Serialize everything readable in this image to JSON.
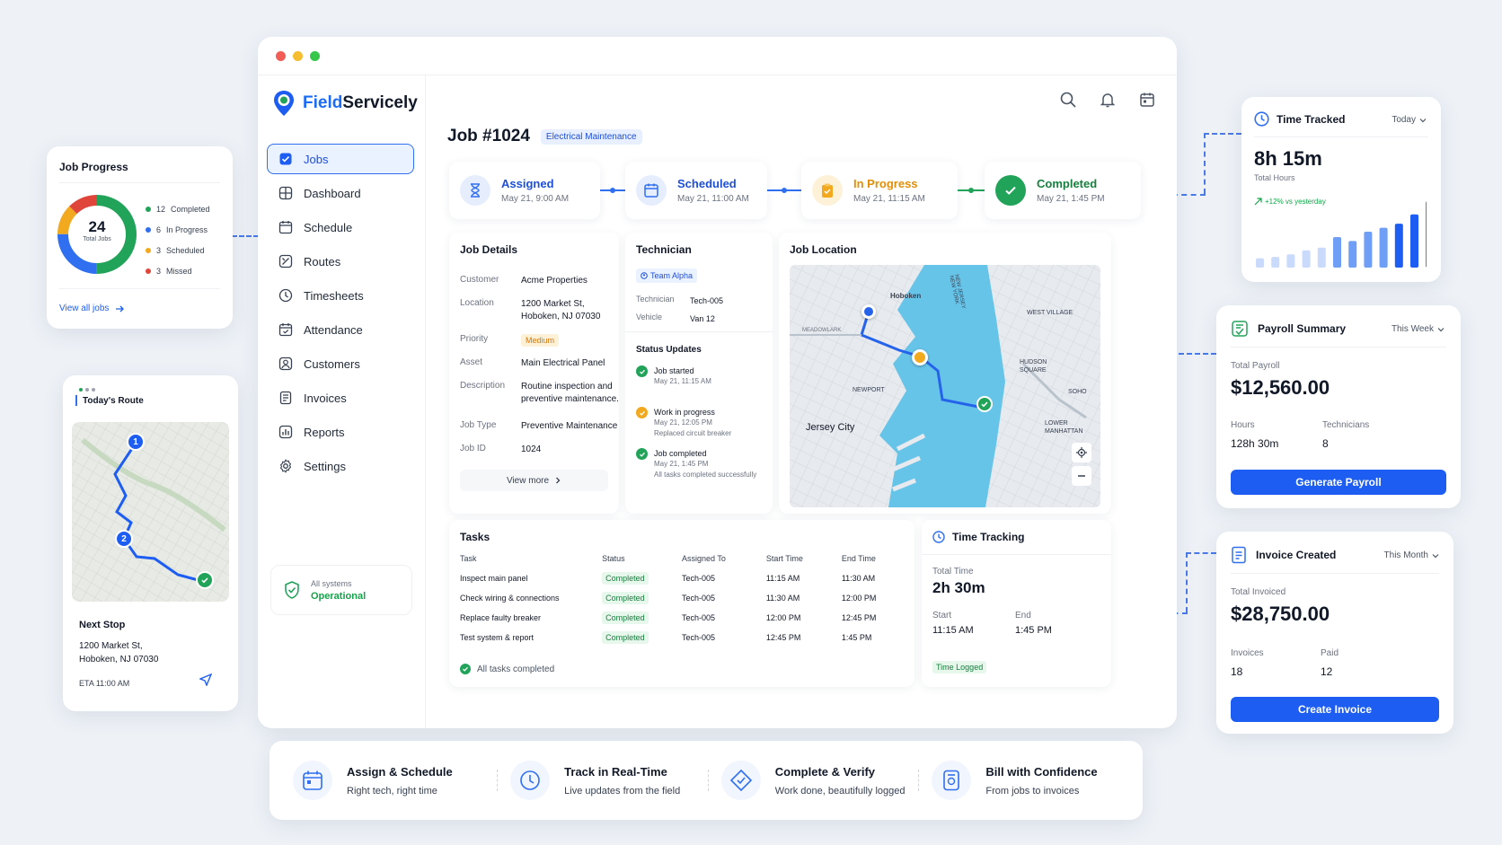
{
  "app": {
    "name_prefix": "Field",
    "name_suffix": "Servicely"
  },
  "colors": {
    "accent": "#1d5df2",
    "success": "#22a35a",
    "warning": "#f2a91d",
    "danger": "#e0453a",
    "map_water": "#67c4e9"
  },
  "window_controls": [
    "close",
    "minimize",
    "maximize"
  ],
  "sidebar": {
    "items": [
      {
        "label": "Jobs",
        "icon": "check-square-icon",
        "active": true
      },
      {
        "label": "Dashboard",
        "icon": "grid-icon"
      },
      {
        "label": "Schedule",
        "icon": "calendar-icon"
      },
      {
        "label": "Routes",
        "icon": "route-icon"
      },
      {
        "label": "Timesheets",
        "icon": "clock-icon"
      },
      {
        "label": "Attendance",
        "icon": "calendar-check-icon"
      },
      {
        "label": "Customers",
        "icon": "user-icon"
      },
      {
        "label": "Invoices",
        "icon": "invoice-icon"
      },
      {
        "label": "Reports",
        "icon": "chart-icon"
      },
      {
        "label": "Settings",
        "icon": "gear-icon"
      }
    ],
    "system": {
      "label": "All systems",
      "status": "Operational"
    }
  },
  "job": {
    "title": "Job #1024",
    "category": "Electrical Maintenance",
    "steps": [
      {
        "label": "Assigned",
        "date": "May 21, 9:00 AM"
      },
      {
        "label": "Scheduled",
        "date": "May 21, 11:00 AM"
      },
      {
        "label": "In Progress",
        "date": "May 21, 11:15 AM"
      },
      {
        "label": "Completed",
        "date": "May 21, 1:45 PM"
      }
    ]
  },
  "job_details": {
    "title": "Job Details",
    "customer": {
      "label": "Customer",
      "value": "Acme Properties"
    },
    "location": {
      "label": "Location",
      "line1": "1200 Market St,",
      "line2": "Hoboken, NJ 07030"
    },
    "priority": {
      "label": "Priority",
      "value": "Medium"
    },
    "asset": {
      "label": "Asset",
      "value": "Main Electrical Panel"
    },
    "description": {
      "label": "Description",
      "line1": "Routine inspection and",
      "line2": "preventive maintenance."
    },
    "job_type": {
      "label": "Job Type",
      "value": "Preventive Maintenance"
    },
    "job_id": {
      "label": "Job ID",
      "value": "1024"
    },
    "view_more": "View more"
  },
  "technician": {
    "title": "Technician",
    "team": "Team Alpha",
    "tech": {
      "label": "Technician",
      "value": "Tech-005"
    },
    "vehicle": {
      "label": "Vehicle",
      "value": "Van 12"
    },
    "updates_title": "Status Updates",
    "updates": [
      {
        "title": "Job started",
        "time": "May 21, 11:15 AM",
        "note": "",
        "color": "#22a35a"
      },
      {
        "title": "Work in progress",
        "time": "May 21, 12:05 PM",
        "note": "Replaced circuit breaker",
        "color": "#f2a91d"
      },
      {
        "title": "Job completed",
        "time": "May 21, 1:45 PM",
        "note": "All tasks completed successfully",
        "color": "#22a35a"
      }
    ]
  },
  "map": {
    "title": "Job Location",
    "labels": [
      "Hoboken",
      "WEST VILLAGE",
      "HUDSON SQUARE",
      "NEWPORT",
      "SOHO",
      "Jersey City",
      "LOWER MANHATTAN",
      "NEW JERSEY NEW YORK",
      "MEADOWLARK"
    ]
  },
  "tasks": {
    "title": "Tasks",
    "columns": [
      "Task",
      "Status",
      "Assigned To",
      "Start Time",
      "End Time"
    ],
    "rows": [
      [
        "Inspect main panel",
        "Completed",
        "Tech-005",
        "11:15 AM",
        "11:30 AM"
      ],
      [
        "Check wiring & connections",
        "Completed",
        "Tech-005",
        "11:30 AM",
        "12:00 PM"
      ],
      [
        "Replace faulty breaker",
        "Completed",
        "Tech-005",
        "12:00 PM",
        "12:45 PM"
      ],
      [
        "Test system & report",
        "Completed",
        "Tech-005",
        "12:45 PM",
        "1:45 PM"
      ]
    ],
    "footer": "All tasks completed"
  },
  "time_tracking": {
    "title": "Time Tracking",
    "total_label": "Total Time",
    "total": "2h 30m",
    "start_label": "Start",
    "start": "11:15 AM",
    "end_label": "End",
    "end": "1:45 PM",
    "badge": "Time Logged"
  },
  "job_progress": {
    "title": "Job Progress",
    "total": "24",
    "total_label": "Total Jobs",
    "legend": [
      {
        "count": "12",
        "label": "Completed",
        "color": "#22a35a",
        "value": 12
      },
      {
        "count": "6",
        "label": "In Progress",
        "color": "#2f6ff0",
        "value": 6
      },
      {
        "count": "3",
        "label": "Scheduled",
        "color": "#f2a91d",
        "value": 3
      },
      {
        "count": "3",
        "label": "Missed",
        "color": "#e0453a",
        "value": 3
      }
    ],
    "link": "View all jobs"
  },
  "route": {
    "title": "Today's Route",
    "stops": [
      "1",
      "2"
    ],
    "next_stop_label": "Next Stop",
    "address1": "1200 Market St,",
    "address2": "Hoboken, NJ 07030",
    "eta": "ETA 11:00 AM"
  },
  "time_tracked": {
    "title": "Time Tracked",
    "range": "Today",
    "value": "8h 15m",
    "label": "Total Hours",
    "trend": "+12% vs yesterday",
    "bars": [
      0.14,
      0.16,
      0.2,
      0.26,
      0.3,
      0.46,
      0.4,
      0.54,
      0.6,
      0.66,
      0.8,
      1.0
    ]
  },
  "payroll": {
    "title": "Payroll Summary",
    "range": "This Week",
    "total_label": "Total Payroll",
    "total": "$12,560.00",
    "hours_label": "Hours",
    "hours": "128h 30m",
    "tech_label": "Technicians",
    "techs": "8",
    "button": "Generate Payroll"
  },
  "invoice": {
    "title": "Invoice Created",
    "range": "This Month",
    "total_label": "Total Invoiced",
    "total": "$28,750.00",
    "invoices_label": "Invoices",
    "invoices": "18",
    "paid_label": "Paid",
    "paid": "12",
    "button": "Create Invoice"
  },
  "features": [
    {
      "title": "Assign & Schedule",
      "sub": "Right tech, right time",
      "icon": "calendar-icon"
    },
    {
      "title": "Track in Real-Time",
      "sub": "Live updates from the field",
      "icon": "clock-icon"
    },
    {
      "title": "Complete & Verify",
      "sub": "Work done, beautifully logged",
      "icon": "diamond-check-icon"
    },
    {
      "title": "Bill with Confidence",
      "sub": "From jobs to invoices",
      "icon": "invoice-icon"
    }
  ]
}
